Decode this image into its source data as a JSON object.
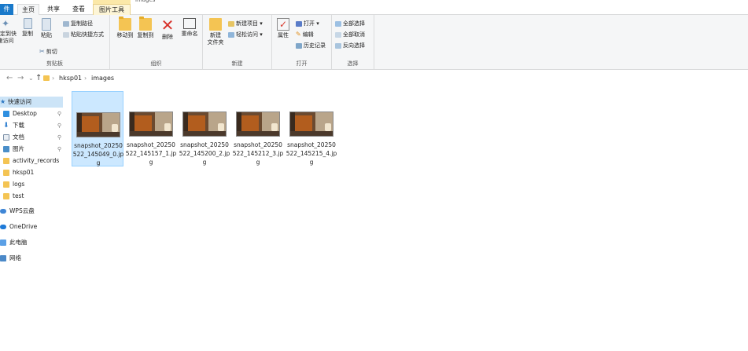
{
  "tabs": {
    "file": "件",
    "home": "主页",
    "share": "共享",
    "view": "查看",
    "picture_tools": "图片工具",
    "window_title_fragment": "images"
  },
  "ribbon": {
    "clipboard": {
      "pin_quick_access": "固定到快\n速访问",
      "copy": "复制",
      "paste": "粘贴",
      "copy_path": "复制路径",
      "paste_shortcut": "粘贴快捷方式",
      "cut": "剪切",
      "label": "剪贴板"
    },
    "organize": {
      "move_to": "移动到",
      "copy_to": "复制到",
      "delete": "删除",
      "rename": "重命名",
      "label": "组织"
    },
    "new": {
      "new_folder": "新建\n文件夹",
      "new_item": "新建项目 ▾",
      "easy_access": "轻松访问 ▾",
      "label": "新建"
    },
    "open": {
      "properties": "属性",
      "open": "打开 ▾",
      "edit": "编辑",
      "history": "历史记录",
      "label": "打开"
    },
    "select": {
      "select_all": "全部选择",
      "select_none": "全部取消",
      "invert": "反向选择",
      "label": "选择"
    }
  },
  "address": {
    "back": "←",
    "forward": "→",
    "recent": "⌄",
    "up": "↑",
    "path": [
      "hksp01",
      "images"
    ]
  },
  "nav": {
    "items": [
      {
        "label": "快速访问",
        "icon": "star-icon",
        "pinned": false
      },
      {
        "label": "Desktop",
        "icon": "desktop-icon",
        "pinned": true
      },
      {
        "label": "下载",
        "icon": "download-icon",
        "pinned": true
      },
      {
        "label": "文档",
        "icon": "document-icon",
        "pinned": true
      },
      {
        "label": "图片",
        "icon": "pictures-icon",
        "pinned": true
      },
      {
        "label": "activity_records",
        "icon": "folder-icon",
        "pinned": false
      },
      {
        "label": "hksp01",
        "icon": "folder-icon",
        "pinned": false
      },
      {
        "label": "logs",
        "icon": "folder-icon",
        "pinned": false
      },
      {
        "label": "test",
        "icon": "folder-icon",
        "pinned": false
      },
      {
        "label": "WPS云盘",
        "icon": "cloud-icon",
        "pinned": false
      },
      {
        "label": "OneDrive",
        "icon": "cloud-icon",
        "pinned": false
      },
      {
        "label": "此电脑",
        "icon": "pc-icon",
        "pinned": false
      },
      {
        "label": "网络",
        "icon": "network-icon",
        "pinned": false
      }
    ],
    "pin_glyph": "📌"
  },
  "files": [
    {
      "name": "snapshot_20250522_145049_0.jpg",
      "selected": true
    },
    {
      "name": "snapshot_20250522_145157_1.jpg",
      "selected": false
    },
    {
      "name": "snapshot_20250522_145200_2.jpg",
      "selected": false
    },
    {
      "name": "snapshot_20250522_145212_3.jpg",
      "selected": false
    },
    {
      "name": "snapshot_20250522_145215_4.jpg",
      "selected": false
    }
  ],
  "colors": {
    "accent": "#1979ca",
    "selection": "#cce8ff",
    "folder": "#f4c453"
  }
}
